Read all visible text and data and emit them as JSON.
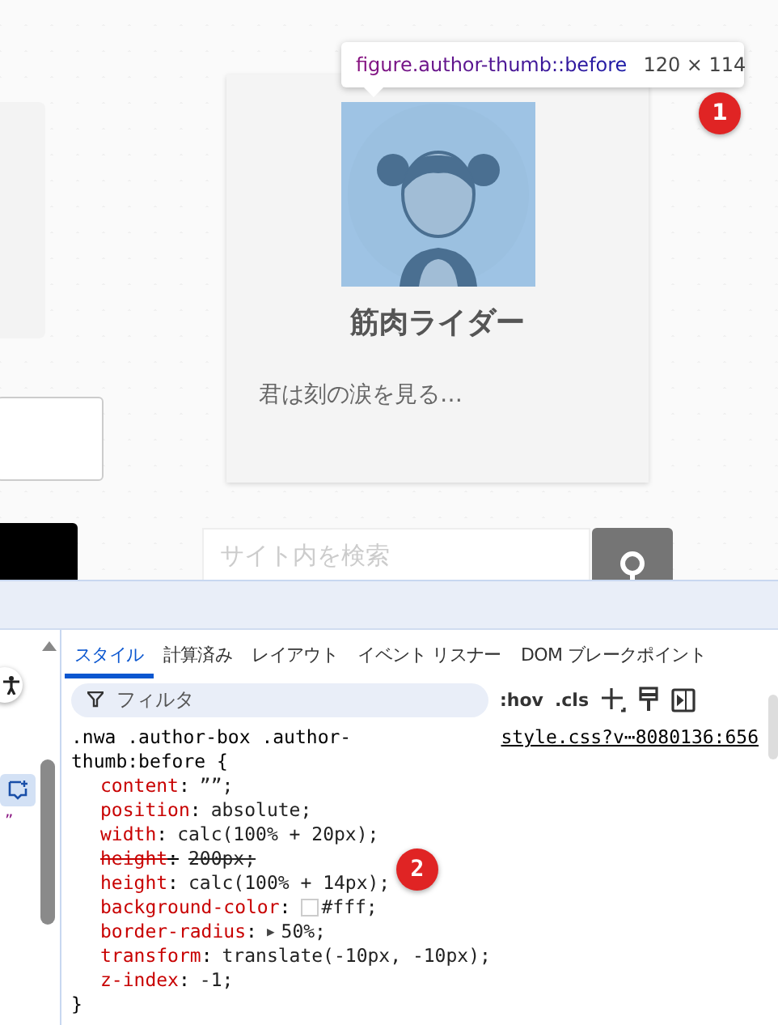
{
  "page": {
    "author_card": {
      "name": "筋肉ライダー",
      "description": "君は刻の涙を見る…"
    },
    "search": {
      "placeholder": "サイト内を検索"
    }
  },
  "tooltip": {
    "selector": "figure.author-thumb::before",
    "size": "120 × 114"
  },
  "badges": [
    "1",
    "2"
  ],
  "devtools": {
    "tabs": [
      {
        "label": "スタイル",
        "selected": true
      },
      {
        "label": "計算済み",
        "selected": false
      },
      {
        "label": "レイアウト",
        "selected": false
      },
      {
        "label": "イベント リスナー",
        "selected": false
      },
      {
        "label": "DOM ブレークポイント",
        "selected": false
      }
    ],
    "filter": {
      "placeholder": "フィルタ"
    },
    "toolbar": [
      ":hov",
      ".cls"
    ],
    "left_pane_text": "”",
    "rule": {
      "separator": ":",
      "selector": ".nwa .author-box .author-thumb:before {",
      "source": "style.css?v⋯8080136:656",
      "close": "}",
      "declarations": [
        {
          "property": "content",
          "value": "””;",
          "overridden": false
        },
        {
          "property": "position",
          "value": "absolute;",
          "overridden": false
        },
        {
          "property": "width",
          "value": "calc(100% + 20px);",
          "overridden": false
        },
        {
          "property": "height",
          "value": "200px;",
          "overridden": true
        },
        {
          "property": "height",
          "value": "calc(100% + 14px);",
          "overridden": false
        },
        {
          "property": "background-color",
          "value": "#fff;",
          "overridden": false,
          "swatch": true
        },
        {
          "property": "border-radius",
          "value": "50%;",
          "overridden": false,
          "toggle": "▶"
        },
        {
          "property": "transform",
          "value": "translate(-10px, -10px);",
          "overridden": false
        },
        {
          "property": "z-index",
          "value": "-1;",
          "overridden": false
        }
      ]
    }
  }
}
